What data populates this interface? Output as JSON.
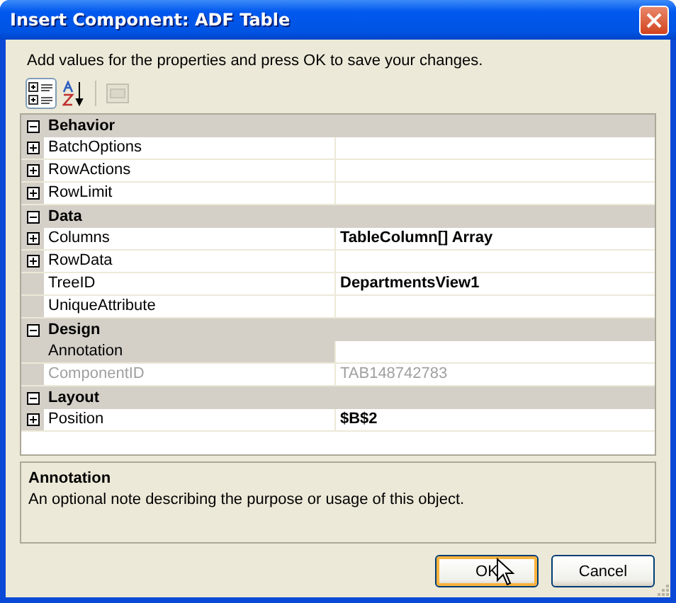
{
  "window": {
    "title": "Insert Component: ADF Table"
  },
  "instructions": "Add values for the properties and press OK to save your changes.",
  "toolbar": [
    {
      "kind": "categorized",
      "selected": true,
      "disabled": false
    },
    {
      "kind": "alphabetical",
      "selected": false,
      "disabled": false
    },
    {
      "kind": "property-pages",
      "selected": false,
      "disabled": true
    }
  ],
  "categories": [
    {
      "name": "Behavior",
      "expanded": true,
      "properties": [
        {
          "name": "BatchOptions",
          "expandable": true,
          "selected": false,
          "disabled": false
        },
        {
          "name": "RowActions",
          "expandable": true,
          "selected": false,
          "disabled": false
        },
        {
          "name": "RowLimit",
          "expandable": true,
          "selected": false,
          "disabled": false
        }
      ]
    },
    {
      "name": "Data",
      "expanded": true,
      "properties": [
        {
          "name": "Columns",
          "value": "TableColumn[] Array",
          "modified": true,
          "expandable": true,
          "selected": false,
          "disabled": false
        },
        {
          "name": "RowData",
          "expandable": true,
          "selected": false,
          "disabled": false
        },
        {
          "name": "TreeID",
          "value": "DepartmentsView1",
          "modified": true,
          "expandable": false,
          "selected": false,
          "disabled": false
        },
        {
          "name": "UniqueAttribute",
          "expandable": false,
          "selected": false,
          "disabled": false
        }
      ]
    },
    {
      "name": "Design",
      "expanded": true,
      "properties": [
        {
          "name": "Annotation",
          "expandable": false,
          "selected": true,
          "disabled": false
        },
        {
          "name": "ComponentID",
          "value": "TAB148742783",
          "modified": false,
          "expandable": false,
          "selected": false,
          "disabled": true
        }
      ]
    },
    {
      "name": "Layout",
      "expanded": true,
      "properties": [
        {
          "name": "Position",
          "value": "$B$2",
          "modified": true,
          "expandable": true,
          "selected": false,
          "disabled": false
        }
      ]
    }
  ],
  "description": {
    "title": "Annotation",
    "text": "An optional note describing the purpose or usage of this object."
  },
  "buttons": [
    {
      "label": "OK",
      "focused": true
    },
    {
      "label": "Cancel",
      "focused": false
    }
  ]
}
